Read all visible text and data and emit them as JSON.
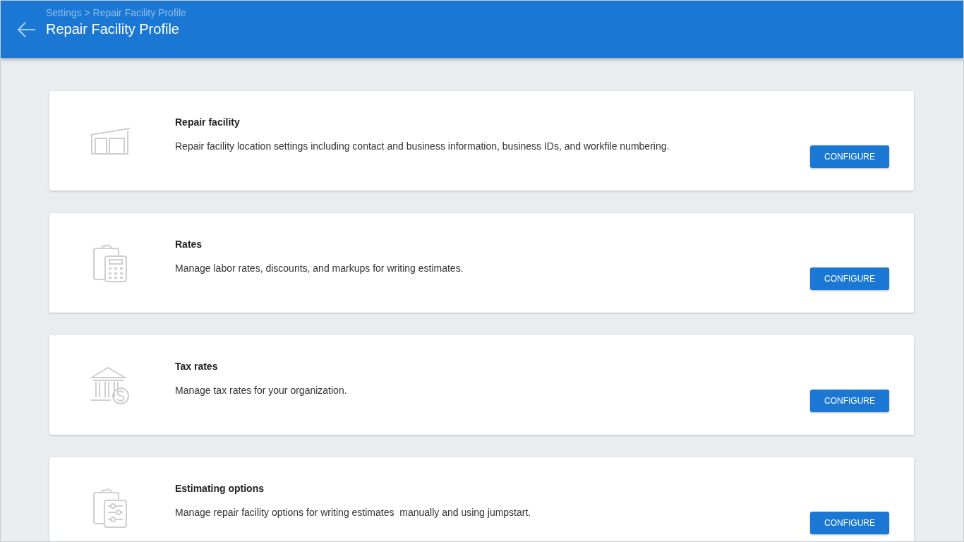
{
  "header": {
    "breadcrumb": "Settings > Repair Facility Profile",
    "title": "Repair Facility Profile"
  },
  "cards": [
    {
      "kind": "garage",
      "title": "Repair facility",
      "description": "Repair facility location settings including contact and business information, business IDs, and workfile numbering.",
      "button": "CONFIGURE"
    },
    {
      "kind": "calculator",
      "title": "Rates",
      "description": "Manage labor rates, discounts, and markups for writing estimates.",
      "button": "CONFIGURE"
    },
    {
      "kind": "bank",
      "title": "Tax rates",
      "description": "Manage tax rates for your organization.",
      "button": "CONFIGURE"
    },
    {
      "kind": "sliders",
      "title": "Estimating options",
      "description": "Manage repair facility options for writing estimates  manually and using jumpstart.",
      "button": "CONFIGURE"
    }
  ]
}
